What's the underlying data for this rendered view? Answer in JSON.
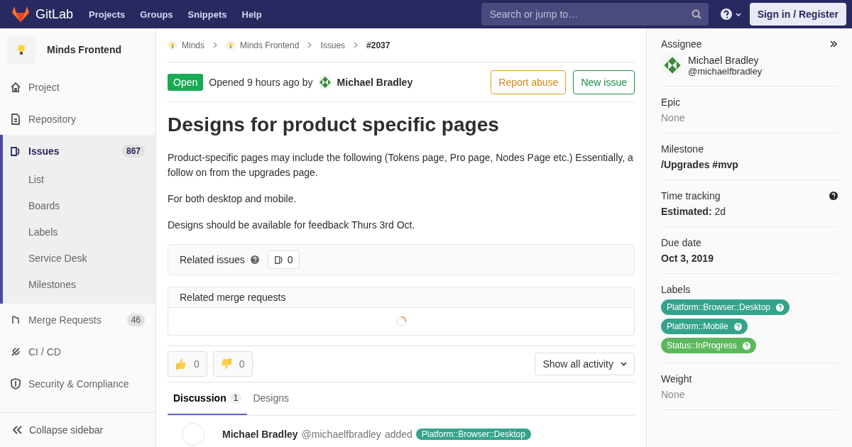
{
  "header": {
    "logo": "GitLab",
    "nav": [
      "Projects",
      "Groups",
      "Snippets",
      "Help"
    ],
    "search": {
      "placeholder": "Search or jump to…"
    },
    "sign_in": "Sign in / Register"
  },
  "sidebar": {
    "project": "Minds Frontend",
    "items": [
      {
        "kind": "project",
        "label": "Project",
        "selected": false
      },
      {
        "kind": "repository",
        "label": "Repository",
        "selected": false
      },
      {
        "kind": "issues",
        "label": "Issues",
        "count": "867",
        "selected": true,
        "children": [
          {
            "label": "List"
          },
          {
            "label": "Boards"
          },
          {
            "label": "Labels"
          },
          {
            "label": "Service Desk"
          },
          {
            "label": "Milestones"
          }
        ]
      },
      {
        "kind": "merge",
        "label": "Merge Requests",
        "count": "46",
        "selected": false
      },
      {
        "kind": "cicd",
        "label": "CI / CD",
        "selected": false
      },
      {
        "kind": "security",
        "label": "Security & Compliance",
        "selected": false
      }
    ],
    "collapse": "Collapse sidebar"
  },
  "breadcrumbs": [
    {
      "kind": "group",
      "label": "Minds"
    },
    {
      "kind": "project",
      "label": "Minds Frontend"
    },
    {
      "kind": "link",
      "label": "Issues"
    },
    {
      "kind": "current",
      "label": "#2037"
    }
  ],
  "issue": {
    "status": "Open",
    "opened": "Opened 9 hours ago by",
    "author": "Michael Bradley",
    "buttons": [
      {
        "kind": "warning",
        "label": "Report abuse"
      },
      {
        "kind": "success",
        "label": "New issue"
      }
    ],
    "title": "Designs for product specific pages",
    "paragraphs": [
      "Product-specific pages may include the following (Tokens page, Pro page, Nodes Page etc.) Essentially, a follow on from the upgrades page.",
      "For both desktop and mobile.",
      "Designs should be available for feedback Thurs 3rd Oct."
    ]
  },
  "related_issues": {
    "label": "Related issues",
    "count": "0"
  },
  "related_merge_requests": {
    "label": "Related merge requests"
  },
  "reactions": [
    {
      "kind": "thumbsup",
      "count": "0"
    },
    {
      "kind": "thumbsdown",
      "count": "0"
    }
  ],
  "activity_filter": "Show all activity",
  "tabs": [
    {
      "label": "Discussion",
      "count": "1",
      "selected": true
    },
    {
      "label": "Designs",
      "selected": false
    }
  ],
  "note": {
    "author": "Michael Bradley",
    "handle": "@michaelfbradley",
    "action": "added",
    "label": "Platform::Browser::Desktop"
  },
  "right": {
    "assignee": {
      "heading": "Assignee",
      "name": "Michael Bradley",
      "handle": "@michaelfbradley"
    },
    "sections": [
      {
        "kind": "muted",
        "heading": "Epic",
        "value": "None"
      },
      {
        "kind": "bold",
        "heading": "Milestone",
        "value": "/Upgrades #mvp"
      },
      {
        "kind": "time",
        "heading": "Time tracking",
        "key": "Estimated:",
        "value": "2d"
      },
      {
        "kind": "bold",
        "heading": "Due date",
        "value": "Oct 3, 2019"
      },
      {
        "kind": "labels",
        "heading": "Labels",
        "labels": [
          {
            "text": "Platform::Browser::Desktop",
            "color": "#34a38b"
          },
          {
            "text": "Platform::Mobile",
            "color": "#34a38b"
          },
          {
            "text": "Status::InProgress",
            "color": "#5cb85c"
          }
        ]
      },
      {
        "kind": "muted",
        "heading": "Weight",
        "value": "None"
      }
    ]
  }
}
